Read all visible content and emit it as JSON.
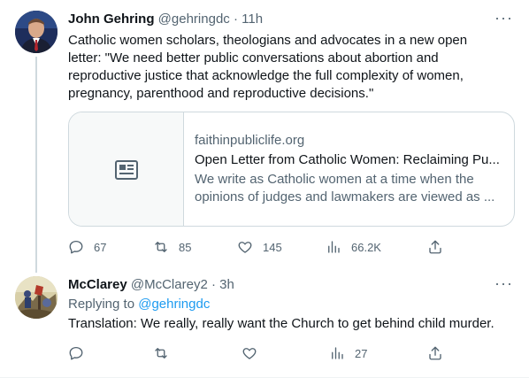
{
  "tweet1": {
    "name": "John Gehring",
    "handle": "@gehringdc",
    "separator": "·",
    "time": "11h",
    "more": "···",
    "text_lines": [
      "Catholic women scholars, theologians and advocates in a new open",
      "letter: \"We need better public conversations about abortion and",
      "reproductive justice that acknowledge the full complexity of women,",
      "pregnancy, parenthood and reproductive decisions.\""
    ],
    "card": {
      "domain": "faithinpubliclife.org",
      "title": "Open Letter from Catholic Women: Reclaiming Pu...",
      "description": "We write as Catholic women at a time when the opinions of judges and lawmakers are viewed as ..."
    },
    "actions": {
      "replies": "67",
      "retweets": "85",
      "likes": "145",
      "views": "66.2K"
    }
  },
  "tweet2": {
    "name": "McClarey",
    "handle": "@McClarey2",
    "separator": "·",
    "time": "3h",
    "more": "···",
    "replying_prefix": "Replying to",
    "replying_handle": "@gehringdc",
    "text": "Translation:  We really, really want the Church to get behind child murder.",
    "actions": {
      "views": "27"
    }
  },
  "icons": [
    "reply-icon",
    "retweet-icon",
    "like-icon",
    "views-icon",
    "share-icon",
    "article-icon",
    "more-icon"
  ],
  "colors": {
    "text": "#0f1419",
    "secondary": "#536471",
    "link": "#1d9bf0",
    "border": "#cfd9de"
  }
}
